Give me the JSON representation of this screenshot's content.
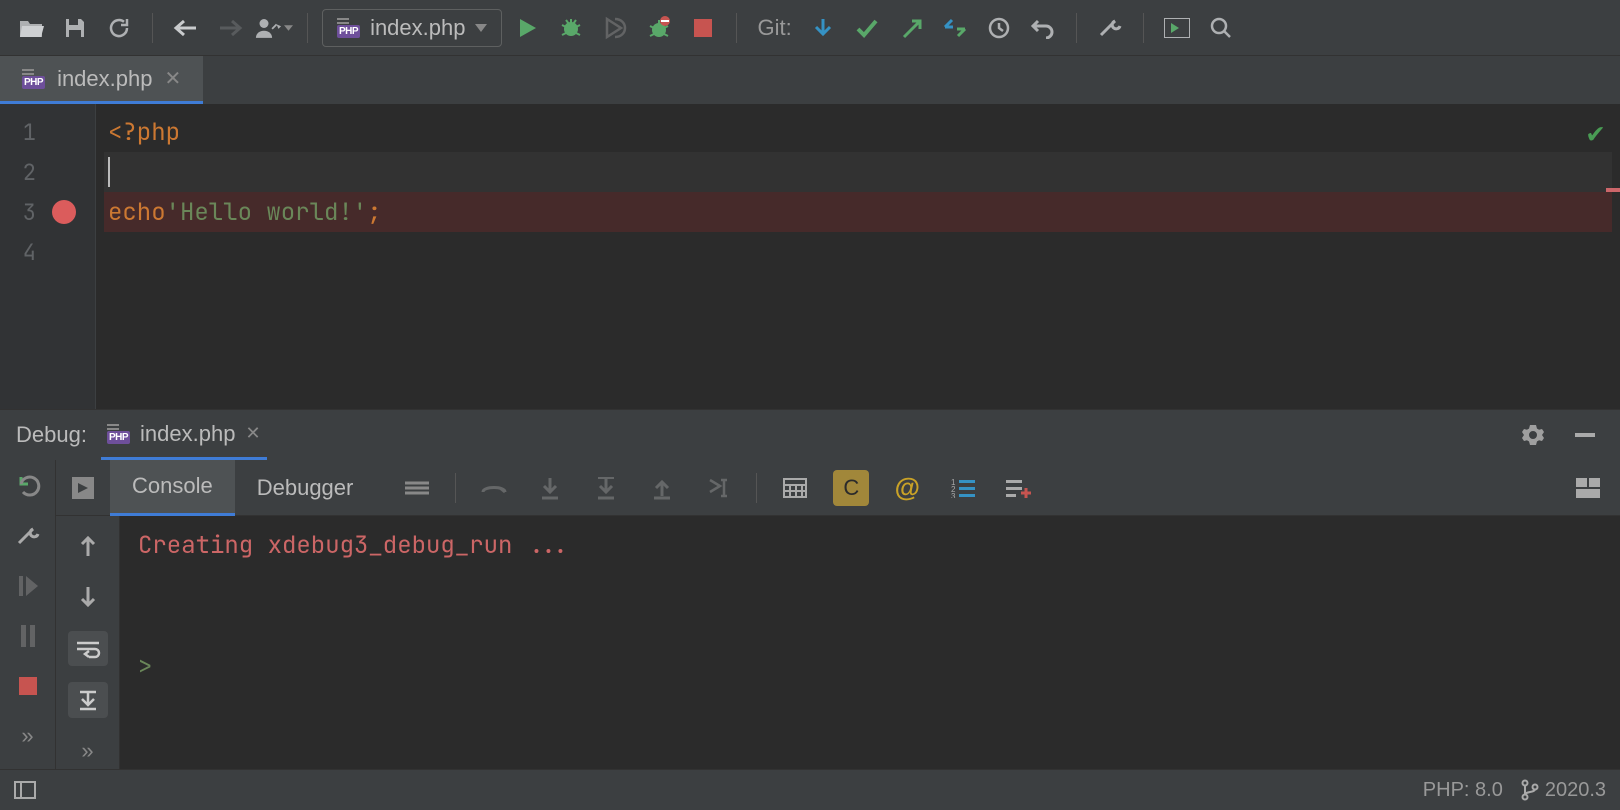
{
  "toolbar": {
    "run_config": "index.php",
    "git_label": "Git:"
  },
  "tab": {
    "filename": "index.php"
  },
  "editor": {
    "lines": [
      "1",
      "2",
      "3",
      "4"
    ],
    "l1_open": "<?php",
    "l3_kw": "echo ",
    "l3_str": "'Hello world!'",
    "l3_semi": ";"
  },
  "debug": {
    "title": "Debug:",
    "config": "index.php",
    "tabs": {
      "console": "Console",
      "debugger": "Debugger"
    },
    "output": "Creating xdebug3_debug_run ...",
    "prompt": ">"
  },
  "status": {
    "php": "PHP: 8.0",
    "branch": "2020.3"
  }
}
